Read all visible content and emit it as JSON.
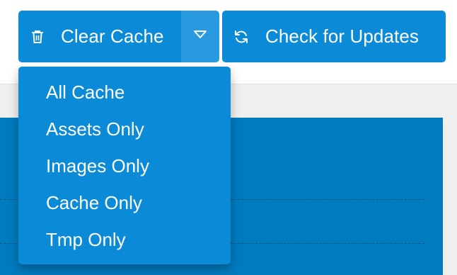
{
  "toolbar": {
    "clear_cache": {
      "label": "Clear Cache",
      "icon": "trash-icon"
    },
    "clear_cache_toggle": {
      "icon": "caret-down-icon"
    },
    "check_updates": {
      "label": "Check for Updates",
      "icon": "refresh-icon"
    }
  },
  "dropdown": {
    "items": [
      {
        "label": "All Cache"
      },
      {
        "label": "Assets Only"
      },
      {
        "label": "Images Only"
      },
      {
        "label": "Cache Only"
      },
      {
        "label": "Tmp Only"
      }
    ]
  },
  "colors": {
    "button": "#0b8ad8",
    "button_toggle": "#2a9ae0",
    "panel": "#007bbd",
    "background": "#efefef"
  }
}
